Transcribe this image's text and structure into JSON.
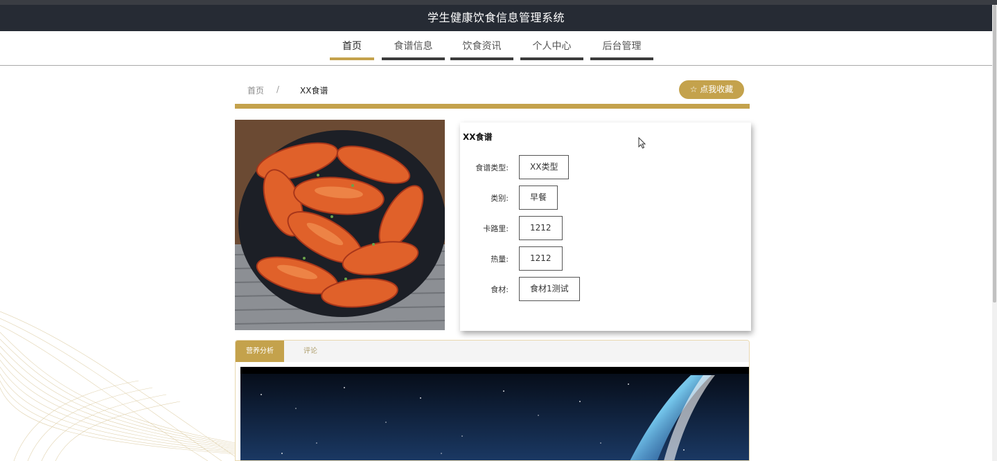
{
  "app": {
    "title": "学生健康饮食信息管理系统"
  },
  "nav": {
    "items": [
      {
        "label": "首页",
        "active": true
      },
      {
        "label": "食谱信息",
        "active": false
      },
      {
        "label": "饮食资讯",
        "active": false
      },
      {
        "label": "个人中心",
        "active": false
      },
      {
        "label": "后台管理",
        "active": false
      }
    ]
  },
  "breadcrumb": {
    "home": "首页",
    "separator": "/",
    "current": "XX食谱"
  },
  "favorite_button": {
    "label": "☆ 点我收藏",
    "icon": "star-icon"
  },
  "recipe": {
    "name": "XX食谱",
    "fields": [
      {
        "label": "食谱类型:",
        "value": "XX类型"
      },
      {
        "label": "类别:",
        "value": "早餐"
      },
      {
        "label": "卡路里:",
        "value": "1212"
      },
      {
        "label": "热量:",
        "value": "1212"
      },
      {
        "label": "食材:",
        "value": "食材1测试"
      }
    ]
  },
  "tabs": {
    "items": [
      {
        "label": "营养分析",
        "active": true
      },
      {
        "label": "评论",
        "active": false
      }
    ]
  },
  "colors": {
    "accent": "#c4a24c",
    "header_bg": "#262b34",
    "nav_underline": "#3c3c3c"
  }
}
